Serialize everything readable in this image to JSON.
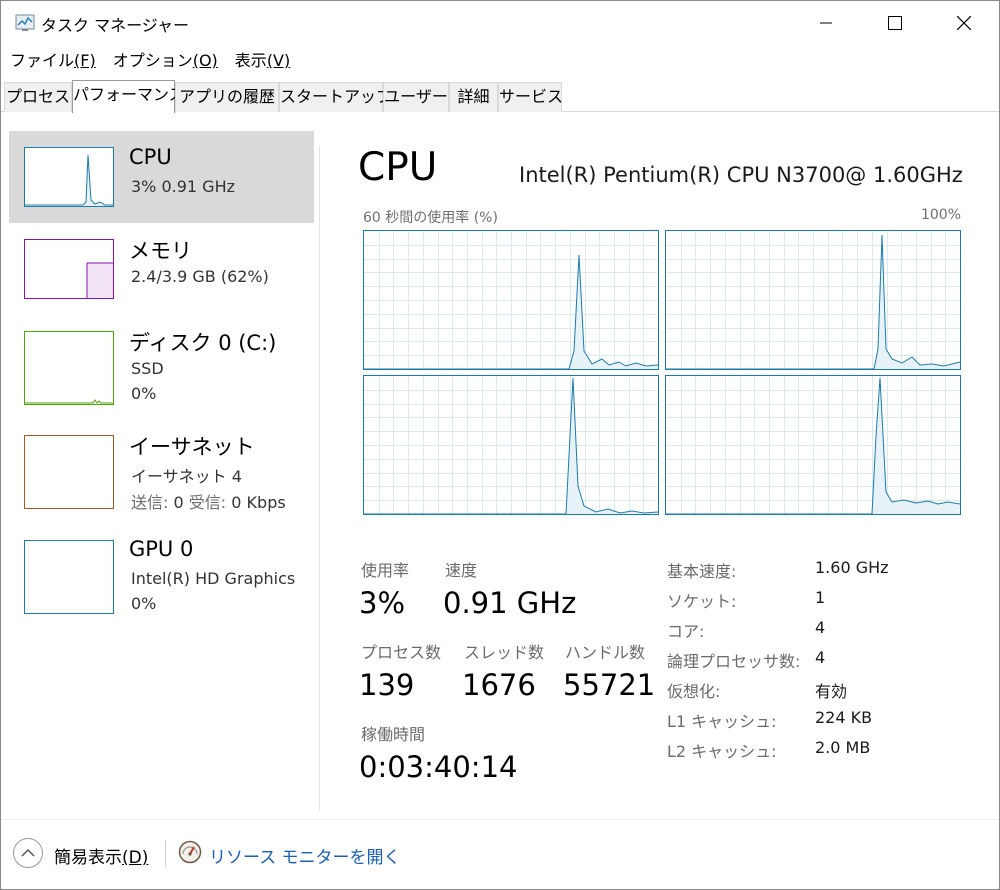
{
  "window": {
    "title": "タスク マネージャー"
  },
  "menu": [
    {
      "label": "ファイル",
      "mnemonic": "(F)"
    },
    {
      "label": "オプション",
      "mnemonic": "(O)"
    },
    {
      "label": "表示",
      "mnemonic": "(V)"
    }
  ],
  "tabs": [
    "プロセス",
    "パフォーマンス",
    "アプリの履歴",
    "スタートアップ",
    "ユーザー",
    "詳細",
    "サービス"
  ],
  "active_tab": "パフォーマンス",
  "sidebar": {
    "cpu": {
      "title": "CPU",
      "line1": "3%  0.91 GHz",
      "color": "#1c7bab"
    },
    "memory": {
      "title": "メモリ",
      "line1": "2.4/3.9 GB (62%)",
      "color": "#8b12ae"
    },
    "disk": {
      "title": "ディスク 0 (C:)",
      "line1": "SSD",
      "line2": "0%",
      "color": "#4da60c"
    },
    "ethernet": {
      "title": "イーサネット",
      "line1": "イーサネット 4",
      "send_label": "送信:",
      "send_value": "0",
      "recv_label": "受信:",
      "recv_value": "0 Kbps",
      "color": "#a7581f"
    },
    "gpu": {
      "title": "GPU 0",
      "line1": "Intel(R) HD Graphics",
      "line2": "0%",
      "color": "#1c7bab"
    }
  },
  "main": {
    "title": "CPU",
    "model": "Intel(R) Pentium(R) CPU N3700@ 1.60GHz",
    "graph_caption": "60 秒間の使用率 (%)",
    "graph_max": "100%"
  },
  "stats": {
    "usage_label": "使用率",
    "usage_value": "3%",
    "speed_label": "速度",
    "speed_value": "0.91 GHz",
    "processes_label": "プロセス数",
    "processes_value": "139",
    "threads_label": "スレッド数",
    "threads_value": "1676",
    "handles_label": "ハンドル数",
    "handles_value": "55721",
    "uptime_label": "稼働時間",
    "uptime_value": "0:03:40:14"
  },
  "specs": [
    {
      "key": "基本速度:",
      "value": "1.60 GHz"
    },
    {
      "key": "ソケット:",
      "value": "1"
    },
    {
      "key": "コア:",
      "value": "4"
    },
    {
      "key": "論理プロセッサ数:",
      "value": "4"
    },
    {
      "key": "仮想化:",
      "value": "有効"
    },
    {
      "key": "L1 キャッシュ:",
      "value": "224 KB"
    },
    {
      "key": "L2 キャッシュ:",
      "value": "2.0 MB"
    }
  ],
  "footer": {
    "collapse_label": "簡易表示",
    "collapse_mnemonic": "(D)",
    "resmon_link": "リソース モニターを開く"
  }
}
